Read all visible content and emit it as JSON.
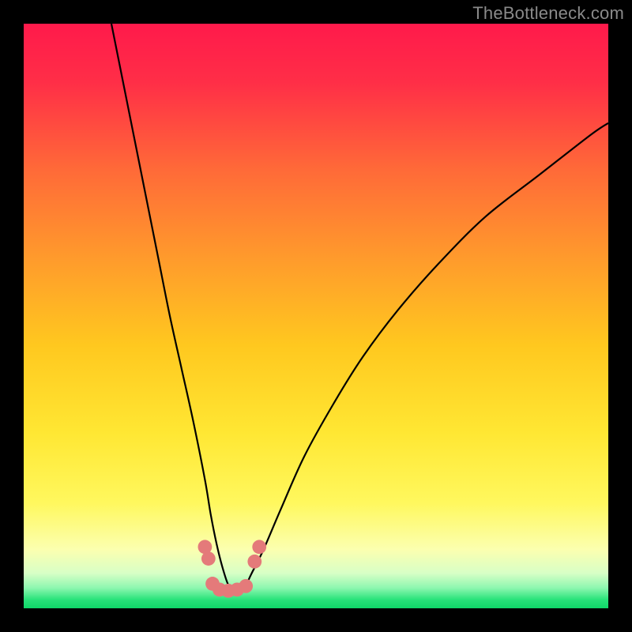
{
  "watermark": "TheBottleneck.com",
  "chart_data": {
    "type": "line",
    "title": "",
    "xlabel": "",
    "ylabel": "",
    "xlim": [
      0,
      100
    ],
    "ylim": [
      0,
      100
    ],
    "gradient_stops": [
      {
        "offset": 0.0,
        "color": "#ff1a4b"
      },
      {
        "offset": 0.1,
        "color": "#ff2e47"
      },
      {
        "offset": 0.25,
        "color": "#ff6a38"
      },
      {
        "offset": 0.4,
        "color": "#ff9a2c"
      },
      {
        "offset": 0.55,
        "color": "#ffc81f"
      },
      {
        "offset": 0.7,
        "color": "#ffe733"
      },
      {
        "offset": 0.82,
        "color": "#fff85e"
      },
      {
        "offset": 0.9,
        "color": "#fbffb0"
      },
      {
        "offset": 0.94,
        "color": "#d8ffc6"
      },
      {
        "offset": 0.965,
        "color": "#8ef7b0"
      },
      {
        "offset": 0.985,
        "color": "#29e37a"
      },
      {
        "offset": 1.0,
        "color": "#0fd768"
      }
    ],
    "series": [
      {
        "name": "bottleneck-curve",
        "x": [
          15,
          17,
          19,
          21,
          23,
          25,
          27,
          29,
          31,
          32,
          33,
          34,
          35,
          36,
          37,
          38,
          39,
          41,
          44,
          48,
          53,
          58,
          64,
          71,
          79,
          88,
          97,
          100
        ],
        "y": [
          100,
          90,
          80,
          70,
          60,
          50,
          41,
          32,
          22,
          16,
          11,
          7,
          4,
          3,
          3,
          4,
          6,
          10,
          17,
          26,
          35,
          43,
          51,
          59,
          67,
          74,
          81,
          83
        ]
      }
    ],
    "markers": {
      "name": "bottleneck-markers",
      "color": "#e47a7a",
      "points": [
        {
          "x": 31.0,
          "y": 10.5,
          "r": 1.2
        },
        {
          "x": 31.6,
          "y": 8.5,
          "r": 1.2
        },
        {
          "x": 32.3,
          "y": 4.2,
          "r": 1.2
        },
        {
          "x": 33.5,
          "y": 3.2,
          "r": 1.2
        },
        {
          "x": 35.0,
          "y": 3.0,
          "r": 1.2
        },
        {
          "x": 36.5,
          "y": 3.2,
          "r": 1.2
        },
        {
          "x": 38.0,
          "y": 3.8,
          "r": 1.2
        },
        {
          "x": 39.5,
          "y": 8.0,
          "r": 1.2
        },
        {
          "x": 40.3,
          "y": 10.5,
          "r": 1.2
        }
      ]
    }
  }
}
